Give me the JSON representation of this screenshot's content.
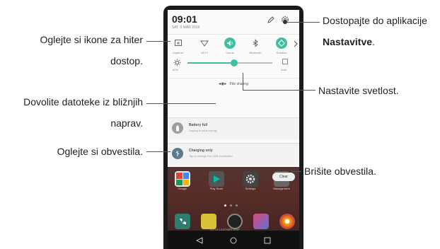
{
  "phone": {
    "time": "09:01",
    "date": "SAT, 5 MAR 2016",
    "quick_settings": [
      {
        "label": "Capture+",
        "icon": "capture-icon"
      },
      {
        "label": "Wi-Fi",
        "icon": "wifi-icon"
      },
      {
        "label": "Sound",
        "icon": "sound-icon"
      },
      {
        "label": "Bluetooth",
        "icon": "bluetooth-icon"
      },
      {
        "label": "Rotation",
        "icon": "rotation-icon"
      }
    ],
    "brightness": {
      "percent_label": "60%",
      "level": 0.55,
      "auto_label": "Auto"
    },
    "file_sharing_label": "File sharing",
    "notifications": [
      {
        "title": "Battery full",
        "text": "Unplug to save energy"
      },
      {
        "title": "Charging only",
        "text": "Tap to change the USB connection"
      }
    ],
    "clear_label": "Clear",
    "apps": [
      "Google",
      "Play Store",
      "Settings",
      "Management"
    ],
    "dock_caption": "LG G5 LEATHER GRIP"
  },
  "annotations": {
    "settings_line1": "Dostopajte do aplikacije",
    "settings_line2": "Nastavitve",
    "settings_line2_suffix": ".",
    "quick_line1": "Oglejte si ikone za hiter",
    "quick_line2": "dostop.",
    "brightness": "Nastavite svetlost.",
    "files_line1": "Dovolite datoteke iz bližnjih",
    "files_line2": "naprav.",
    "notifications": "Oglejte si obvestila.",
    "clear": "Brišite obvestila."
  },
  "colors": {
    "accent": "#3fbf9f",
    "notif_icon_a": "#9e9e9e",
    "notif_icon_b": "#5c7a8e"
  }
}
